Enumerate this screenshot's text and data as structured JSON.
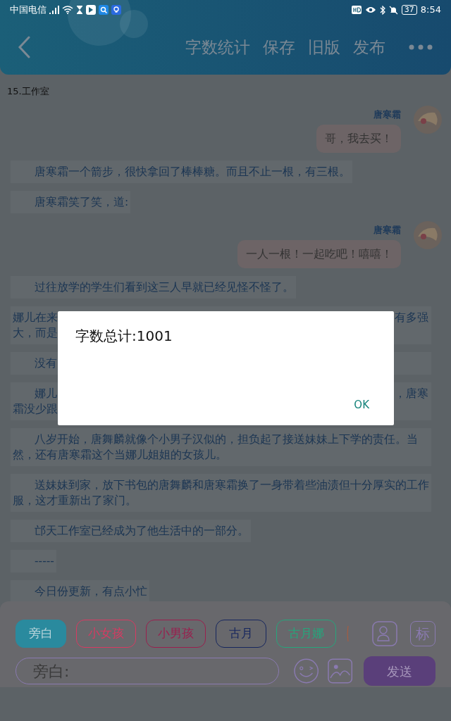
{
  "status_bar": {
    "carrier": "中国电信",
    "battery": "37",
    "time": "8:54"
  },
  "toolbar": {
    "actions": [
      "字数统计",
      "保存",
      "旧版",
      "发布"
    ]
  },
  "chapter_title": "15.工作室",
  "feed": [
    {
      "kind": "message",
      "speaker": "唐寒霜",
      "text": "哥，我去买！"
    },
    {
      "kind": "narration",
      "text": "唐寒霜一个箭步，很快拿回了棒棒糖。而且不止一根，有三根。"
    },
    {
      "kind": "narration",
      "text": "唐寒霜笑了笑，道:"
    },
    {
      "kind": "message",
      "speaker": "唐寒霜",
      "text": "一人一根！一起吃吧！嘻嘻！"
    },
    {
      "kind": "narration",
      "text": "过往放学的学生们看到这三人早就已经见怪不怪了。"
    },
    {
      "kind": "partial",
      "lines": [
        {
          "left": "娜儿在来",
          "right": "有多强",
          "indent": false
        },
        {
          "left": "大，而是",
          "indent": false
        }
      ]
    },
    {
      "kind": "partial",
      "lines": [
        {
          "left": "没有",
          "indent": true
        }
      ]
    },
    {
      "kind": "partial",
      "lines": [
        {
          "left": "娜儿",
          "right": "，唐寒",
          "indent": true
        },
        {
          "left": "霜没少跟",
          "indent": false
        }
      ]
    },
    {
      "kind": "narration",
      "text": "八岁开始，唐舞麟就像个小男子汉似的，担负起了接送妹妹上下学的责任。当然，还有唐寒霜这个当娜儿姐姐的女孩儿。"
    },
    {
      "kind": "narration",
      "text": "送妹妹到家，放下书包的唐舞麟和唐寒霜换了一身带着些油渍但十分厚实的工作服，这才重新出了家门。"
    },
    {
      "kind": "narration",
      "text": "邙天工作室已经成为了他生活中的一部分。"
    },
    {
      "kind": "narration",
      "text": "-----"
    },
    {
      "kind": "narration",
      "text": "今日份更新，有点小忙"
    }
  ],
  "roles": [
    {
      "label": "旁白",
      "color": "#2a8a9e",
      "selected": true
    },
    {
      "label": "小女孩",
      "color": "#d83a62",
      "selected": false
    },
    {
      "label": "小男孩",
      "color": "#9a1f4e",
      "selected": false
    },
    {
      "label": "古月",
      "color": "#16265e",
      "selected": false
    },
    {
      "label": "古月娜",
      "color": "#25a67c",
      "selected": false
    }
  ],
  "tag_button": "标",
  "input": {
    "placeholder": "旁白:"
  },
  "send_button": "发送",
  "dialog": {
    "message": "字数总计:1001",
    "button": "OK"
  }
}
